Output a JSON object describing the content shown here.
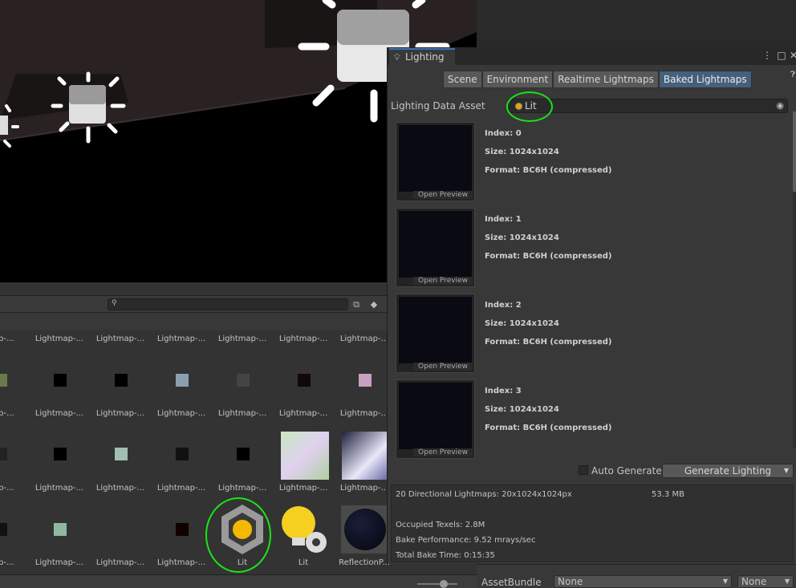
{
  "lighting_window": {
    "title": "Lighting",
    "tabs": [
      {
        "label": "Scene",
        "selected": false
      },
      {
        "label": "Environment",
        "selected": false
      },
      {
        "label": "Realtime Lightmaps",
        "selected": false
      },
      {
        "label": "Baked Lightmaps",
        "selected": true
      }
    ],
    "lighting_data_asset": {
      "label": "Lighting Data Asset",
      "value": "Lit"
    },
    "lightmaps": [
      {
        "index": "Index: 0",
        "size": "Size: 1024x1024",
        "format": "Format: BC6H (compressed)",
        "preview": "Open Preview"
      },
      {
        "index": "Index: 1",
        "size": "Size: 1024x1024",
        "format": "Format: BC6H (compressed)",
        "preview": "Open Preview"
      },
      {
        "index": "Index: 2",
        "size": "Size: 1024x1024",
        "format": "Format: BC6H (compressed)",
        "preview": "Open Preview"
      },
      {
        "index": "Index: 3",
        "size": "Size: 1024x1024",
        "format": "Format: BC6H (compressed)",
        "preview": "Open Preview"
      }
    ],
    "auto_generate": {
      "label": "Auto Generate",
      "checked": false
    },
    "generate_button": "Generate Lighting",
    "stats": {
      "summary": "20 Directional Lightmaps: 20x1024x1024px",
      "memory": "53.3 MB",
      "occupied": "Occupied Texels: 2.8M",
      "performance": "Bake Performance: 9.52 mrays/sec",
      "time": "Total Bake Time: 0:15:35"
    }
  },
  "project": {
    "search": {
      "placeholder": ""
    },
    "row_labels": [
      "map-...",
      "Lightmap-...",
      "Lightmap-...",
      "Lightmap-...",
      "Lightmap-...",
      "Lightmap-...",
      "Lightmap-..."
    ],
    "row4_labels": [
      "map-...",
      "Lightmap-...",
      "Lightmap-...",
      "Lightmap-...",
      "Lit",
      "Lit",
      "ReflectionP..."
    ]
  },
  "inspector": {
    "assetbundle_label": "AssetBundle",
    "bundle_value": "None",
    "variant_value": "None"
  },
  "colors": {
    "accent": "#46607c",
    "annotation": "#17e617",
    "lit_icon": "#f5b800"
  }
}
